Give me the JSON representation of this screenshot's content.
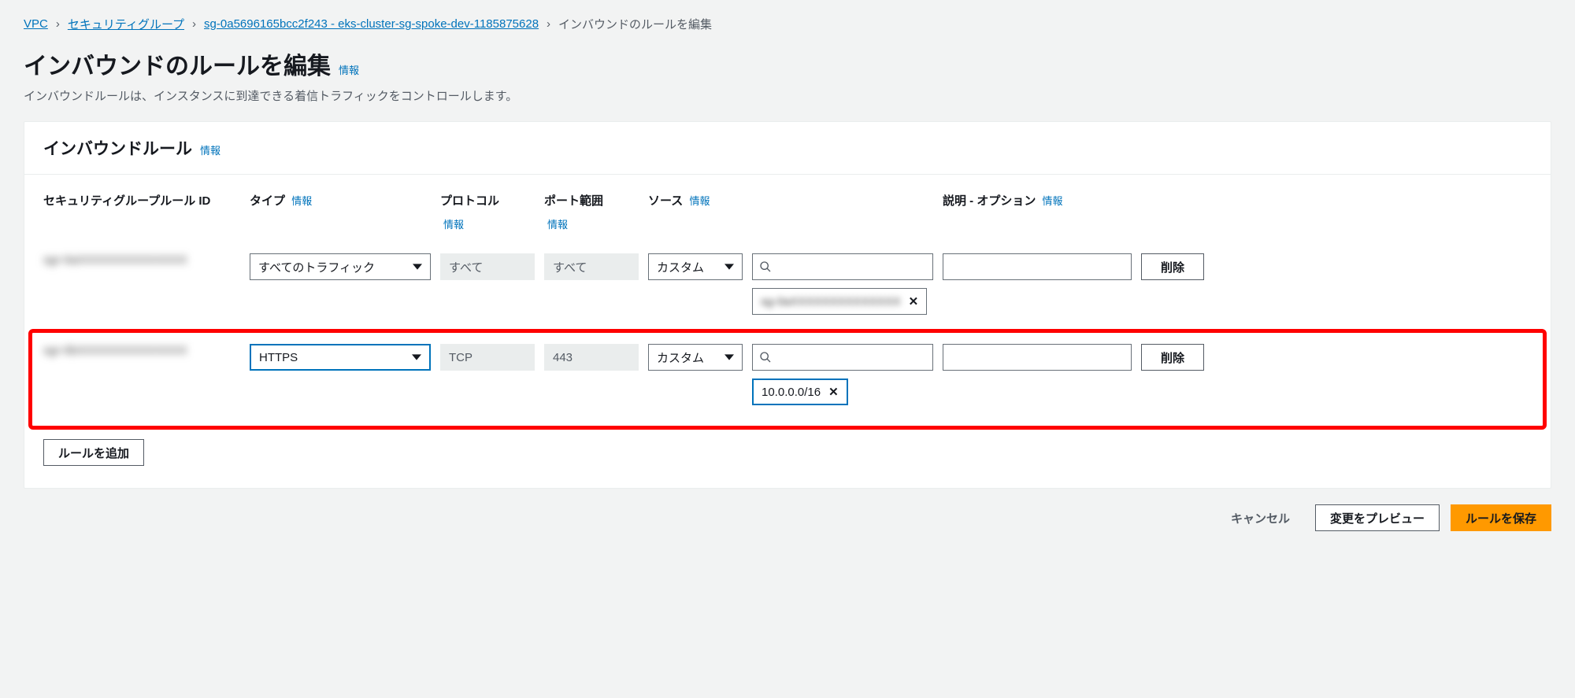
{
  "breadcrumb": {
    "vpc": "VPC",
    "sg": "セキュリティグループ",
    "sg_id": "sg-0a5696165bcc2f243 - eks-cluster-sg-spoke-dev-1185875628",
    "current": "インバウンドのルールを編集"
  },
  "page": {
    "title": "インバウンドのルールを編集",
    "info": "情報",
    "description": "インバウンドルールは、インスタンスに到達できる着信トラフィックをコントロールします。"
  },
  "panel": {
    "title": "インバウンドルール",
    "info": "情報"
  },
  "columns": {
    "rule_id": "セキュリティグループルール ID",
    "type": "タイプ",
    "protocol": "プロトコル",
    "port_range": "ポート範囲",
    "source": "ソース",
    "description": "説明 - オプション",
    "info": "情報"
  },
  "rules": [
    {
      "id_obscured": "sgr-0aXXXXXXXXXXXXXX",
      "type": "すべてのトラフィック",
      "protocol": "すべて",
      "port_range": "すべて",
      "source_mode": "カスタム",
      "source_chip_obscured": "sg-0aXXXXXXXXXXXXXX",
      "description": "",
      "delete": "削除"
    },
    {
      "id_obscured": "sgr-0bXXXXXXXXXXXXXX",
      "type": "HTTPS",
      "protocol": "TCP",
      "port_range": "443",
      "source_mode": "カスタム",
      "source_chip": "10.0.0.0/16",
      "description": "",
      "delete": "削除"
    }
  ],
  "actions": {
    "add_rule": "ルールを追加",
    "cancel": "キャンセル",
    "preview": "変更をプレビュー",
    "save": "ルールを保存"
  }
}
